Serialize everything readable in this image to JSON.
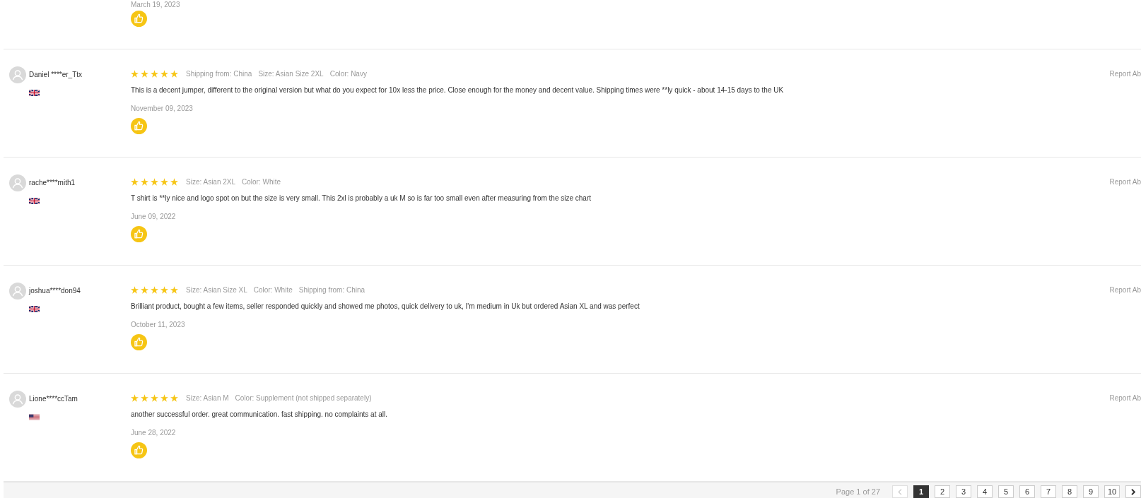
{
  "previous_review": {
    "date": "March 19, 2023"
  },
  "reviews": [
    {
      "reviewer": "Daniel ****er_Ttx",
      "flag": {
        "kind": "uk"
      },
      "stars": 5,
      "attributes": [
        "Shipping from: China",
        "Size: Asian Size 2XL",
        "Color: Navy"
      ],
      "text": "This is a decent jumper, different to the original version but what do you expect for 10x less the price. Close enough for the money and decent value. Shipping times were **ly quick - about 14-15 days to the UK",
      "date": "November 09, 2023",
      "report_link": "Report Ab"
    },
    {
      "reviewer": "rache****mith1",
      "flag": {
        "kind": "uk"
      },
      "stars": 5,
      "attributes": [
        "Size: Asian 2XL",
        "Color: White"
      ],
      "text": "T shirt is **ly nice and logo spot on but the size is very small. This 2xl is probably a uk M so is far too small even after measuring from the size chart",
      "date": "June 09, 2022",
      "report_link": "Report Ab"
    },
    {
      "reviewer": "joshua****don94",
      "flag": {
        "kind": "uk"
      },
      "stars": 5,
      "attributes": [
        "Size: Asian Size XL",
        "Color: White",
        "Shipping from: China"
      ],
      "text": "Brilliant product, bought a few items, seller responded quickly and showed me photos, quick delivery to uk, I'm medium in Uk but ordered Asian XL and was perfect",
      "date": "October 11, 2023",
      "report_link": "Report Ab"
    },
    {
      "reviewer": "Lione****ccTam",
      "flag": {
        "kind": "us"
      },
      "stars": 5,
      "attributes": [
        "Size: Asian M",
        "Color: Supplement (not shipped separately)"
      ],
      "text": "another successful order. great communication. fast shipping. no complaints at all.",
      "date": "June 28, 2022",
      "report_link": "Report Ab"
    }
  ],
  "pagination": {
    "summary": "Page 1 of 27",
    "previous": {
      "disabled": true
    },
    "pages": [
      {
        "label": "1",
        "selected": true
      },
      {
        "label": "2",
        "selected": false
      },
      {
        "label": "3",
        "selected": false
      },
      {
        "label": "4",
        "selected": false
      },
      {
        "label": "5",
        "selected": false
      },
      {
        "label": "6",
        "selected": false
      },
      {
        "label": "7",
        "selected": false
      },
      {
        "label": "8",
        "selected": false
      },
      {
        "label": "9",
        "selected": false
      },
      {
        "label": "10",
        "selected": false
      }
    ],
    "next": {
      "disabled": false
    }
  }
}
